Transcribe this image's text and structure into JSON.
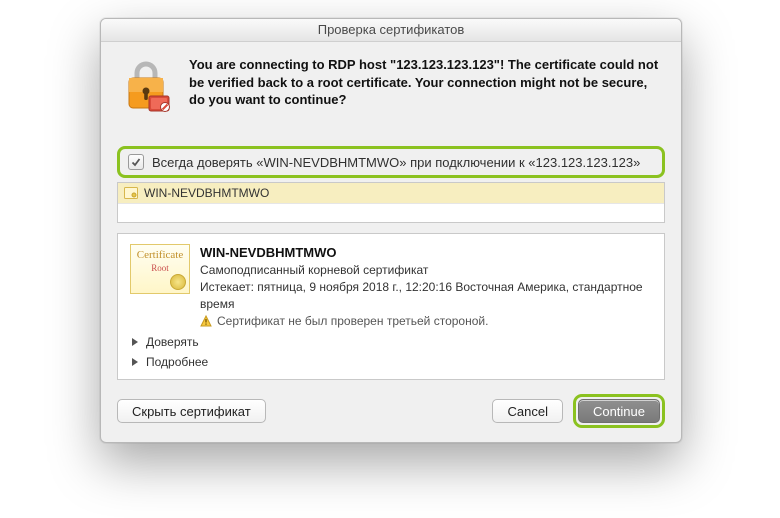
{
  "window": {
    "title": "Проверка сертификатов"
  },
  "warning": {
    "text": "You are connecting to RDP host \"123.123.123.123\"! The certificate could not be verified back to a root certificate. Your connection might not be secure, do you want to continue?"
  },
  "always_trust": {
    "checked": true,
    "label": "Всегда доверять «WIN-NEVDBHMTMWO» при подключении к «123.123.123.123»"
  },
  "cert_list": {
    "items": [
      {
        "name": "WIN-NEVDBHMTMWO"
      }
    ]
  },
  "cert_details": {
    "badge_title": "Certificate",
    "badge_root": "Root",
    "name": "WIN-NEVDBHMTMWO",
    "type": "Самоподписанный корневой сертификат",
    "expires": "Истекает: пятница, 9 ноября 2018 г., 12:20:16 Восточная Америка, стандартное время",
    "warning": "Сертификат не был проверен третьей стороной."
  },
  "disclosures": {
    "trust": "Доверять",
    "details": "Подробнее"
  },
  "buttons": {
    "hide_cert": "Скрыть сертификат",
    "cancel": "Cancel",
    "continue": "Continue"
  }
}
